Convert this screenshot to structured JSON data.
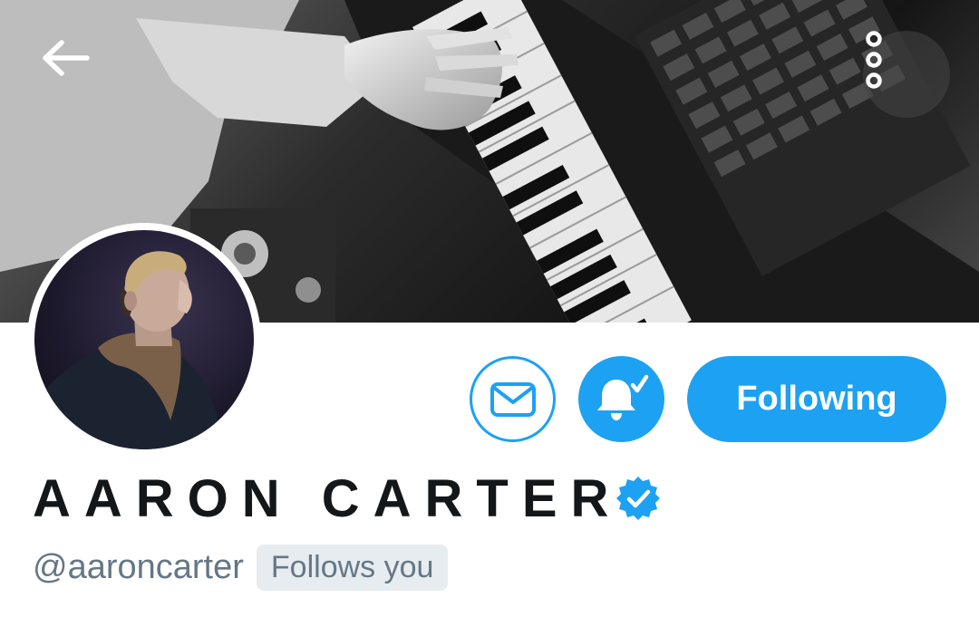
{
  "header": {
    "back_icon": "arrow-left-icon",
    "more_icon": "more-vertical-icon",
    "banner_description": "black-and-white photo of hands playing a synthesizer keyboard"
  },
  "profile": {
    "display_name": "AARON CARTER",
    "handle": "@aaroncarter",
    "follows_you_label": "Follows you",
    "verified": true
  },
  "actions": {
    "message_icon": "envelope-icon",
    "notifications_icon": "bell-check-icon",
    "following_label": "Following"
  },
  "colors": {
    "accent": "#1da1f2",
    "name_text": "#14171a",
    "secondary_text": "#657786",
    "badge_bg": "#e6ecf0"
  }
}
